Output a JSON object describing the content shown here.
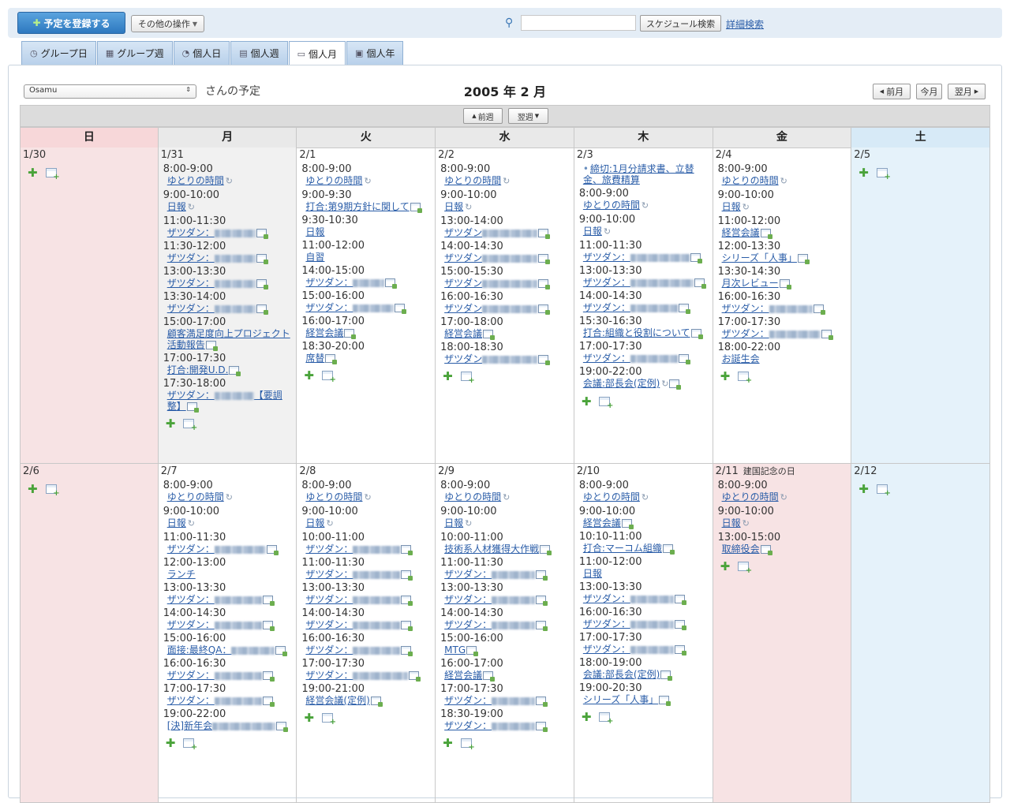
{
  "toolbar": {
    "register_label": "予定を登録する",
    "other_ops_label": "その他の操作",
    "search_placeholder": "",
    "search_button": "スケジュール検索",
    "advanced_search": "詳細検索"
  },
  "tabs": [
    {
      "label": "グループ日",
      "icon": "group-day-icon"
    },
    {
      "label": "グループ週",
      "icon": "group-week-icon"
    },
    {
      "label": "個人日",
      "icon": "personal-day-icon"
    },
    {
      "label": "個人週",
      "icon": "personal-week-icon"
    },
    {
      "label": "個人月",
      "icon": "personal-month-icon",
      "active": true
    },
    {
      "label": "個人年",
      "icon": "personal-year-icon"
    }
  ],
  "header": {
    "user": "Osamu",
    "user_suffix": "さんの予定",
    "month_title": "2005 年 2 月",
    "prev_month": "前月",
    "this_month": "今月",
    "next_month": "翌月",
    "prev_week": "前週",
    "next_week": "翌週"
  },
  "weekdays": [
    "日",
    "月",
    "火",
    "水",
    "木",
    "金",
    "土"
  ],
  "weeks": [
    {
      "days": [
        {
          "date": "1/30",
          "type": "sun",
          "events": []
        },
        {
          "date": "1/31",
          "type": "today",
          "events": [
            {
              "time": "8:00-9:00",
              "title": "ゆとりの時間",
              "repeat": true
            },
            {
              "time": "9:00-10:00",
              "title": "日報",
              "repeat": true
            },
            {
              "time": "11:00-11:30",
              "title": "ザツダン：",
              "blur": 52,
              "cal": true
            },
            {
              "time": "11:30-12:00",
              "title": "ザツダン：",
              "blur": 52,
              "cal": true
            },
            {
              "time": "13:00-13:30",
              "title": "ザツダン：",
              "blur": 52,
              "cal": true
            },
            {
              "time": "13:30-14:00",
              "title": "ザツダン：",
              "blur": 52,
              "cal": true
            },
            {
              "time": "15:00-17:00",
              "title": "顧客満足度向上プロジェクト活動報告",
              "cal": true
            },
            {
              "time": "17:00-17:30",
              "title": "打合:開発U.D.",
              "cal": true
            },
            {
              "time": "17:30-18:00",
              "title": "ザツダン：",
              "blur": 50,
              "after": "【要調整】",
              "cal": true
            }
          ]
        },
        {
          "date": "2/1",
          "type": "",
          "events": [
            {
              "time": "8:00-9:00",
              "title": "ゆとりの時間",
              "repeat": true
            },
            {
              "time": "9:00-9:30",
              "title": "打合:第9期方針に関して",
              "cal": true
            },
            {
              "time": "9:30-10:30",
              "title": "日報"
            },
            {
              "time": "11:00-12:00",
              "title": "自習"
            },
            {
              "time": "14:00-15:00",
              "title": "ザツダン：",
              "blur": 40,
              "cal": true
            },
            {
              "time": "15:00-16:00",
              "title": "ザツダン：",
              "blur": 52,
              "cal": true
            },
            {
              "time": "16:00-17:00",
              "title": "経営会議",
              "cal": true
            },
            {
              "time": "18:30-20:00",
              "title": "席替",
              "cal": true
            }
          ]
        },
        {
          "date": "2/2",
          "type": "",
          "events": [
            {
              "time": "8:00-9:00",
              "title": "ゆとりの時間",
              "repeat": true
            },
            {
              "time": "9:00-10:00",
              "title": "日報",
              "repeat": true
            },
            {
              "time": "13:00-14:00",
              "title": "ザツダン",
              "blur": 70,
              "cal": true
            },
            {
              "time": "14:00-14:30",
              "title": "ザツダン",
              "blur": 70,
              "cal": true
            },
            {
              "time": "15:00-15:30",
              "title": "ザツダン",
              "blur": 70,
              "cal": true
            },
            {
              "time": "16:00-16:30",
              "title": "ザツダン",
              "blur": 70,
              "cal": true
            },
            {
              "time": "17:00-18:00",
              "title": "経営会議",
              "cal": true
            },
            {
              "time": "18:00-18:30",
              "title": "ザツダン",
              "blur": 70,
              "cal": true
            }
          ]
        },
        {
          "date": "2/3",
          "type": "",
          "events": [
            {
              "time": "",
              "title": "締切:1月分請求書、立替金、旅費精算",
              "bullet": true
            },
            {
              "time": "8:00-9:00",
              "title": "ゆとりの時間",
              "repeat": true
            },
            {
              "time": "9:00-10:00",
              "title": "日報",
              "repeat": true
            },
            {
              "time": "11:00-11:30",
              "title": "ザツダン：",
              "blur": 75,
              "cal": true
            },
            {
              "time": "13:00-13:30",
              "title": "ザツダン：",
              "blur": 80,
              "cal": true
            },
            {
              "time": "14:00-14:30",
              "title": "ザツダン：",
              "blur": 60,
              "cal": true
            },
            {
              "time": "15:30-16:30",
              "title": "打合:組織と役割について",
              "cal": true
            },
            {
              "time": "17:00-17:30",
              "title": "ザツダン：",
              "blur": 60,
              "cal": true
            },
            {
              "time": "19:00-22:00",
              "title": "会議:部長会(定例)",
              "repeat": true,
              "cal": true
            }
          ]
        },
        {
          "date": "2/4",
          "type": "",
          "events": [
            {
              "time": "8:00-9:00",
              "title": "ゆとりの時間",
              "repeat": true
            },
            {
              "time": "9:00-10:00",
              "title": "日報",
              "repeat": true
            },
            {
              "time": "11:00-12:00",
              "title": "経営会議",
              "cal": true
            },
            {
              "time": "12:00-13:30",
              "title": "シリーズ「人事」",
              "cal": true
            },
            {
              "time": "13:30-14:30",
              "title": "月次レビュー",
              "cal": true
            },
            {
              "time": "16:00-16:30",
              "title": "ザツダン：",
              "blur": 55,
              "cal": true
            },
            {
              "time": "17:00-17:30",
              "title": "ザツダン：",
              "blur": 65,
              "cal": true
            },
            {
              "time": "18:00-22:00",
              "title": "お誕生会"
            }
          ]
        },
        {
          "date": "2/5",
          "type": "sat",
          "events": []
        }
      ]
    },
    {
      "days": [
        {
          "date": "2/6",
          "type": "sun",
          "events": []
        },
        {
          "date": "2/7",
          "type": "",
          "events": [
            {
              "time": "8:00-9:00",
              "title": "ゆとりの時間",
              "repeat": true
            },
            {
              "time": "9:00-10:00",
              "title": "日報",
              "repeat": true
            },
            {
              "time": "11:00-11:30",
              "title": "ザツダン：",
              "blur": 65,
              "cal": true
            },
            {
              "time": "12:00-13:00",
              "title": "ランチ"
            },
            {
              "time": "13:00-13:30",
              "title": "ザツダン：",
              "blur": 60,
              "cal": true
            },
            {
              "time": "14:00-14:30",
              "title": "ザツダン：",
              "blur": 60,
              "cal": true
            },
            {
              "time": "15:00-16:00",
              "title": "面接:最終QA：",
              "blur": 55,
              "cal": true
            },
            {
              "time": "16:00-16:30",
              "title": "ザツダン：",
              "blur": 60,
              "cal": true
            },
            {
              "time": "17:00-17:30",
              "title": "ザツダン：",
              "blur": 60,
              "cal": true
            },
            {
              "time": "19:00-22:00",
              "title": "[決]新年会",
              "blur": 80,
              "cal": true
            }
          ]
        },
        {
          "date": "2/8",
          "type": "",
          "events": [
            {
              "time": "8:00-9:00",
              "title": "ゆとりの時間",
              "repeat": true
            },
            {
              "time": "9:00-10:00",
              "title": "日報",
              "repeat": true
            },
            {
              "time": "10:00-11:00",
              "title": "ザツダン：",
              "blur": 60,
              "cal": true
            },
            {
              "time": "11:00-11:30",
              "title": "ザツダン：",
              "blur": 60,
              "cal": true
            },
            {
              "time": "13:00-13:30",
              "title": "ザツダン：",
              "blur": 60,
              "cal": true
            },
            {
              "time": "14:00-14:30",
              "title": "ザツダン：",
              "blur": 60,
              "cal": true
            },
            {
              "time": "16:00-16:30",
              "title": "ザツダン：",
              "blur": 60,
              "cal": true
            },
            {
              "time": "17:00-17:30",
              "title": "ザツダン：",
              "blur": 70,
              "cal": true
            },
            {
              "time": "19:00-21:00",
              "title": "経営会議(定例)",
              "cal": true
            }
          ]
        },
        {
          "date": "2/9",
          "type": "",
          "events": [
            {
              "time": "8:00-9:00",
              "title": "ゆとりの時間",
              "repeat": true
            },
            {
              "time": "9:00-10:00",
              "title": "日報",
              "repeat": true
            },
            {
              "time": "10:00-11:00",
              "title": "技術系人材獲得大作戦",
              "cal": true
            },
            {
              "time": "11:00-11:30",
              "title": "ザツダン：",
              "blur": 55,
              "cal": true
            },
            {
              "time": "13:00-13:30",
              "title": "ザツダン：",
              "blur": 55,
              "cal": true
            },
            {
              "time": "14:00-14:30",
              "title": "ザツダン：",
              "blur": 55,
              "cal": true
            },
            {
              "time": "15:00-16:00",
              "title": "MTG",
              "cal": true
            },
            {
              "time": "16:00-17:00",
              "title": "経営会議",
              "cal": true
            },
            {
              "time": "17:00-17:30",
              "title": "ザツダン：",
              "blur": 55,
              "cal": true
            },
            {
              "time": "18:30-19:00",
              "title": "ザツダン：",
              "blur": 55,
              "cal": true
            }
          ]
        },
        {
          "date": "2/10",
          "type": "",
          "events": [
            {
              "time": "8:00-9:00",
              "title": "ゆとりの時間",
              "repeat": true
            },
            {
              "time": "9:00-10:00",
              "title": "経営会議",
              "cal": true
            },
            {
              "time": "10:10-11:00",
              "title": "打合:マーコム組織",
              "cal": true
            },
            {
              "time": "11:00-12:00",
              "title": "日報"
            },
            {
              "time": "13:00-13:30",
              "title": "ザツダン：",
              "blur": 55,
              "cal": true
            },
            {
              "time": "16:00-16:30",
              "title": "ザツダン：",
              "blur": 55,
              "cal": true
            },
            {
              "time": "17:00-17:30",
              "title": "ザツダン：",
              "blur": 55,
              "cal": true
            },
            {
              "time": "18:00-19:00",
              "title": "会議:部長会(定例)",
              "cal": true
            },
            {
              "time": "19:00-20:30",
              "title": "シリーズ「人事」",
              "cal": true
            }
          ]
        },
        {
          "date": "2/11",
          "holiday": "建国記念の日",
          "type": "hol",
          "events": [
            {
              "time": "8:00-9:00",
              "title": "ゆとりの時間",
              "repeat": true
            },
            {
              "time": "9:00-10:00",
              "title": "日報",
              "repeat": true
            },
            {
              "time": "13:00-15:00",
              "title": "取締役会",
              "cal": true
            }
          ]
        },
        {
          "date": "2/12",
          "type": "sat",
          "events": []
        }
      ]
    }
  ]
}
